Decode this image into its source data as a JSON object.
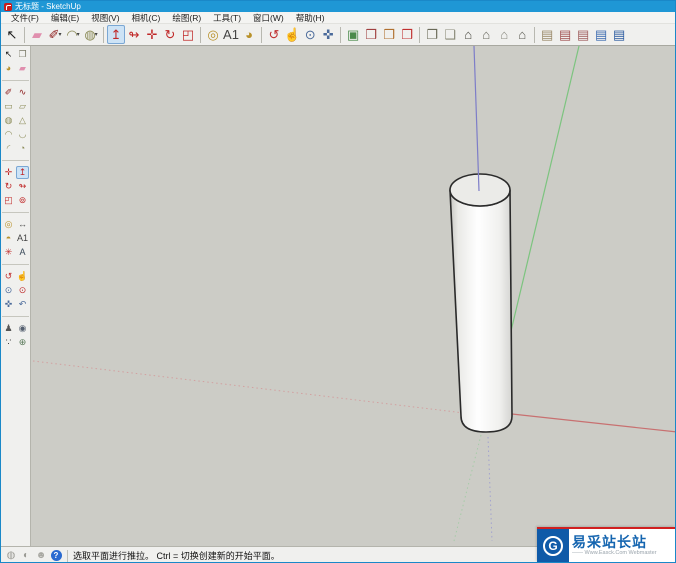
{
  "window": {
    "title": "无标题 - SketchUp"
  },
  "menu": {
    "items": [
      {
        "name": "menu-file",
        "label": "文件(F)"
      },
      {
        "name": "menu-edit",
        "label": "编辑(E)"
      },
      {
        "name": "menu-view",
        "label": "视图(V)"
      },
      {
        "name": "menu-camera",
        "label": "相机(C)"
      },
      {
        "name": "menu-draw",
        "label": "绘图(R)"
      },
      {
        "name": "menu-tools",
        "label": "工具(T)"
      },
      {
        "name": "menu-window",
        "label": "窗口(W)"
      },
      {
        "name": "menu-help",
        "label": "帮助(H)"
      }
    ]
  },
  "toolbar": {
    "items": [
      {
        "name": "select-tool-icon",
        "glyph": "↖",
        "color": "#1a1a1a"
      },
      {
        "sep": true
      },
      {
        "name": "eraser-tool-icon",
        "glyph": "▰",
        "color": "#e08fae"
      },
      {
        "name": "line-tool-icon",
        "glyph": "✐",
        "color": "#8b1a1a",
        "dropdown": true
      },
      {
        "name": "arc-tool-icon",
        "glyph": "◠",
        "color": "#8a8a56",
        "dropdown": true
      },
      {
        "name": "circle-tool-icon",
        "glyph": "◍",
        "color": "#8a8a56",
        "dropdown": true
      },
      {
        "sep": true
      },
      {
        "name": "push-pull-tool-icon",
        "glyph": "↥",
        "color": "#c02828",
        "selected": true
      },
      {
        "name": "follow-me-tool-icon",
        "glyph": "↬",
        "color": "#c02828"
      },
      {
        "name": "move-tool-icon",
        "glyph": "✛",
        "color": "#c02828"
      },
      {
        "name": "rotate-tool-icon",
        "glyph": "↻",
        "color": "#c02828"
      },
      {
        "name": "scale-tool-icon",
        "glyph": "◰",
        "color": "#c02828"
      },
      {
        "sep": true
      },
      {
        "name": "tape-measure-tool-icon",
        "glyph": "◎",
        "color": "#b8912a"
      },
      {
        "name": "text-tool-icon",
        "glyph": "A1",
        "color": "#444444"
      },
      {
        "name": "paint-bucket-tool-icon",
        "glyph": "◕",
        "color": "#b8912a"
      },
      {
        "sep": true
      },
      {
        "name": "orbit-tool-icon",
        "glyph": "↺",
        "color": "#c03030"
      },
      {
        "name": "pan-tool-icon",
        "glyph": "☝",
        "color": "#8a8a82"
      },
      {
        "name": "zoom-tool-icon",
        "glyph": "⊙",
        "color": "#4a6a9a"
      },
      {
        "name": "zoom-extents-tool-icon",
        "glyph": "✜",
        "color": "#4a6a9a"
      },
      {
        "sep": true
      },
      {
        "name": "image-view-icon",
        "glyph": "▣",
        "color": "#4a8a4a"
      },
      {
        "name": "get-models-icon",
        "glyph": "❒",
        "color": "#a04040"
      },
      {
        "name": "share-model-icon",
        "glyph": "❒",
        "color": "#b07030"
      },
      {
        "name": "share-component-icon",
        "glyph": "❒",
        "color": "#c03030"
      },
      {
        "sep": true
      },
      {
        "name": "view-iso-icon",
        "glyph": "❐",
        "color": "#6a6a58"
      },
      {
        "name": "view-top-icon",
        "glyph": "❑",
        "color": "#8a8a78"
      },
      {
        "name": "view-front-icon",
        "glyph": "⌂",
        "color": "#4a4a42"
      },
      {
        "name": "view-right-icon",
        "glyph": "⌂",
        "color": "#6a6a60"
      },
      {
        "name": "view-back-icon",
        "glyph": "⌂",
        "color": "#8a8a80"
      },
      {
        "name": "view-left-icon",
        "glyph": "⌂",
        "color": "#5a5a52"
      },
      {
        "sep": true
      },
      {
        "name": "warehouse-component-icon",
        "glyph": "▤",
        "color": "#9a8a6a"
      },
      {
        "name": "warehouse-get-icon",
        "glyph": "▤",
        "color": "#a05050"
      },
      {
        "name": "warehouse-share-icon",
        "glyph": "▤",
        "color": "#a06060"
      },
      {
        "name": "warehouse-upload-icon",
        "glyph": "▤",
        "color": "#3a6ab0"
      },
      {
        "name": "warehouse-blue-icon",
        "glyph": "▤",
        "color": "#2a5aa0"
      }
    ]
  },
  "left_toolbar": {
    "items": [
      {
        "name": "select-tool-icon",
        "glyph": "↖",
        "color": "#1a1a1a"
      },
      {
        "name": "make-component-icon",
        "glyph": "❐",
        "color": "#7a7a68"
      },
      {
        "name": "paint-bucket-tool-icon",
        "glyph": "◕",
        "color": "#b8912a"
      },
      {
        "name": "eraser-tool-icon",
        "glyph": "▰",
        "color": "#e08fae"
      },
      {
        "sep": true
      },
      {
        "name": "line-tool-icon",
        "glyph": "✐",
        "color": "#8b1a1a"
      },
      {
        "name": "freehand-tool-icon",
        "glyph": "∿",
        "color": "#8b1a1a"
      },
      {
        "name": "rectangle-tool-icon",
        "glyph": "▭",
        "color": "#8a8a56"
      },
      {
        "name": "rotated-rectangle-tool-icon",
        "glyph": "▱",
        "color": "#8a8a56"
      },
      {
        "name": "circle-tool-icon",
        "glyph": "◍",
        "color": "#8a8a56"
      },
      {
        "name": "polygon-tool-icon",
        "glyph": "△",
        "color": "#8a8a56"
      },
      {
        "name": "arc-tool-icon",
        "glyph": "◠",
        "color": "#8a8a56"
      },
      {
        "name": "two-point-arc-tool-icon",
        "glyph": "◡",
        "color": "#8a8a56"
      },
      {
        "name": "three-point-arc-tool-icon",
        "glyph": "◜",
        "color": "#8a8a56"
      },
      {
        "name": "pie-tool-icon",
        "glyph": "◔",
        "color": "#8a8a56"
      },
      {
        "sep": true
      },
      {
        "name": "move-tool-icon",
        "glyph": "✛",
        "color": "#c02828"
      },
      {
        "name": "push-pull-tool-icon",
        "glyph": "↥",
        "color": "#c02828",
        "selected": true
      },
      {
        "name": "rotate-tool-icon",
        "glyph": "↻",
        "color": "#c02828"
      },
      {
        "name": "follow-me-tool-icon",
        "glyph": "↬",
        "color": "#c02828"
      },
      {
        "name": "scale-tool-icon",
        "glyph": "◰",
        "color": "#c02828"
      },
      {
        "name": "offset-tool-icon",
        "glyph": "⊚",
        "color": "#c02828"
      },
      {
        "sep": true
      },
      {
        "name": "tape-measure-tool-icon",
        "glyph": "◎",
        "color": "#b8912a"
      },
      {
        "name": "dimension-tool-icon",
        "glyph": "↔",
        "color": "#555555"
      },
      {
        "name": "protractor-tool-icon",
        "glyph": "◓",
        "color": "#b8912a"
      },
      {
        "name": "text-tool-icon",
        "glyph": "A1",
        "color": "#444444"
      },
      {
        "name": "axes-tool-icon",
        "glyph": "✳",
        "color": "#c03030"
      },
      {
        "name": "three-d-text-tool-icon",
        "glyph": "A",
        "color": "#3a4a5a"
      },
      {
        "sep": true
      },
      {
        "name": "orbit-tool-icon",
        "glyph": "↺",
        "color": "#c03030"
      },
      {
        "name": "pan-tool-icon",
        "glyph": "☝",
        "color": "#8a8a82"
      },
      {
        "name": "zoom-tool-icon",
        "glyph": "⊙",
        "color": "#4a6a9a"
      },
      {
        "name": "zoom-window-tool-icon",
        "glyph": "⊙",
        "color": "#c03030"
      },
      {
        "name": "zoom-extents-tool-icon",
        "glyph": "✜",
        "color": "#4a6a9a"
      },
      {
        "name": "previous-view-tool-icon",
        "glyph": "↶",
        "color": "#4a6a9a"
      },
      {
        "sep": true
      },
      {
        "name": "position-camera-tool-icon",
        "glyph": "♟",
        "color": "#555555"
      },
      {
        "name": "look-around-tool-icon",
        "glyph": "◉",
        "color": "#556070"
      },
      {
        "name": "walk-tool-icon",
        "glyph": "∵",
        "color": "#333333"
      },
      {
        "name": "section-plane-tool-icon",
        "glyph": "⊕",
        "color": "#5a7a5a"
      }
    ]
  },
  "status_bar": {
    "icons": [
      {
        "name": "geolocation-icon",
        "glyph": "◍",
        "color": "#9a9a94"
      },
      {
        "name": "credits-icon",
        "glyph": "◐",
        "color": "#9a9a94"
      },
      {
        "name": "sign-in-icon",
        "glyph": "☻",
        "color": "#a8a8a2"
      },
      {
        "name": "help-icon",
        "glyph": "?",
        "color": "#ffffff",
        "bg": "#2a6ad0"
      }
    ],
    "message": "选取平面进行推拉。 Ctrl = 切换创建新的开始平面。"
  },
  "canvas": {
    "model": "cylinder",
    "background": "#ccccc6",
    "axis_colors": {
      "blue-solid": "#7d7dc8",
      "green-solid": "#7cc47f",
      "red-solid": "#c87070",
      "blue-dotted": "#a2a2ce",
      "green-dotted": "#a6cba8",
      "red-dotted": "#d2a0a0"
    }
  },
  "watermark": {
    "logo_glyph": "G",
    "logo_color": "#0f5aa8",
    "title": "易采站长站",
    "subtitle": "—— Www.Easck.Com Webmaster",
    "accent_color": "#d02020"
  }
}
